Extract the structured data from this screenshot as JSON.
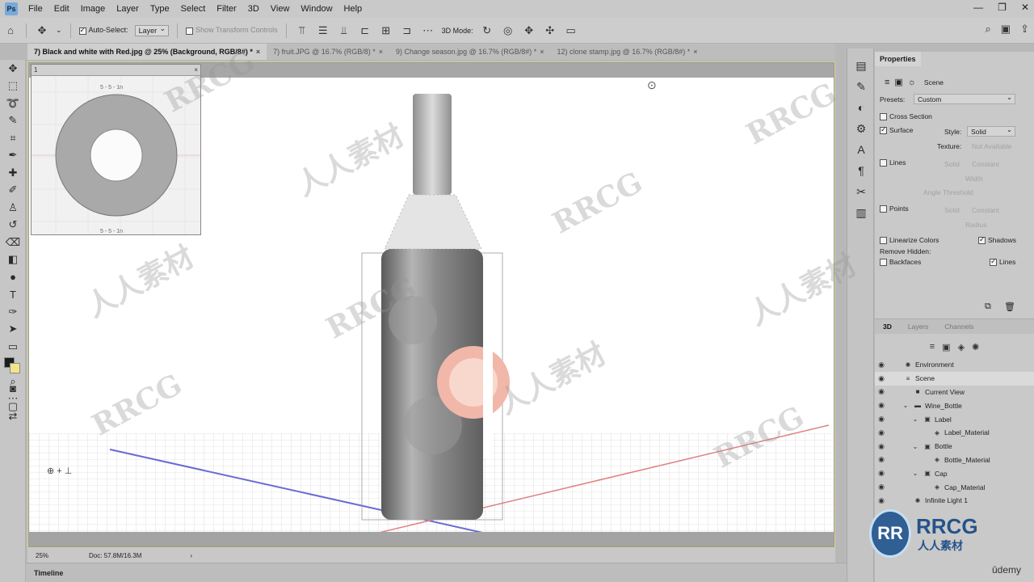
{
  "app": {
    "logo": "Ps"
  },
  "menu": [
    "File",
    "Edit",
    "Image",
    "Layer",
    "Type",
    "Select",
    "Filter",
    "3D",
    "View",
    "Window",
    "Help"
  ],
  "options": {
    "auto_select_label": "Auto-Select:",
    "auto_select_checked": true,
    "auto_select_value": "Layer",
    "transform_controls": "Show Transform Controls",
    "mode_label": "3D Mode:"
  },
  "tabs": [
    {
      "label": "7) Black and white with Red.jpg @ 25% (Background, RGB/8#) *",
      "active": true
    },
    {
      "label": "7) fruit.JPG @ 16.7% (RGB/8) *",
      "active": false
    },
    {
      "label": "9) Change season.jpg @ 16.7% (RGB/8#) *",
      "active": false
    },
    {
      "label": "12) clone stamp.jpg @ 16.7% (RGB/8#) *",
      "active": false
    }
  ],
  "uv_panel": {
    "title": "1",
    "ruler_top": "5 - 5 - 1n",
    "ruler_bottom": "5 - 5 - 1n"
  },
  "status": {
    "zoom": "25%",
    "doc": "Doc: 57.8M/16.3M"
  },
  "timeline": {
    "label": "Timeline"
  },
  "properties": {
    "title": "Properties",
    "mode": "Scene",
    "presets_label": "Presets:",
    "presets_value": "Custom",
    "cross_section": "Cross Section",
    "surface": "Surface",
    "surface_checked": true,
    "style_label": "Style:",
    "style_value": "Solid",
    "texture_label": "Texture:",
    "texture_value": "Not Available",
    "lines": "Lines",
    "lines_style": "Solid",
    "lines_color": "Constant",
    "lines_width": "Width",
    "lines_angle": "Angle Threshold",
    "points": "Points",
    "points_style": "Solid",
    "points_color": "Constant",
    "points_radius": "Radius",
    "linearize": "Linearize Colors",
    "shadows": "Shadows",
    "shadows_checked": true,
    "remove_hidden": "Remove Hidden:",
    "backfaces": "Backfaces",
    "remove_lines": "Lines",
    "remove_lines_checked": true
  },
  "panel3d": {
    "tabs": [
      "3D",
      "Layers",
      "Channels"
    ],
    "tree": [
      {
        "label": "Environment",
        "indent": 0,
        "icon": "environment-icon",
        "glyph": "✺",
        "caret": ""
      },
      {
        "label": "Scene",
        "indent": 0,
        "icon": "scene-icon",
        "glyph": "≡",
        "caret": "",
        "selected": true
      },
      {
        "label": "Current View",
        "indent": 1,
        "icon": "camera-icon",
        "glyph": "■",
        "caret": ""
      },
      {
        "label": "Wine_Bottle",
        "indent": 1,
        "icon": "folder-icon",
        "glyph": "▬",
        "caret": "⌄"
      },
      {
        "label": "Label",
        "indent": 2,
        "icon": "mesh-icon",
        "glyph": "▣",
        "caret": "⌄"
      },
      {
        "label": "Label_Material",
        "indent": 3,
        "icon": "material-icon",
        "glyph": "◈",
        "caret": ""
      },
      {
        "label": "Bottle",
        "indent": 2,
        "icon": "mesh-icon",
        "glyph": "▣",
        "caret": "⌄"
      },
      {
        "label": "Bottle_Material",
        "indent": 3,
        "icon": "material-icon",
        "glyph": "◈",
        "caret": ""
      },
      {
        "label": "Cap",
        "indent": 2,
        "icon": "mesh-icon",
        "glyph": "▣",
        "caret": "⌄"
      },
      {
        "label": "Cap_Material",
        "indent": 3,
        "icon": "material-icon",
        "glyph": "◈",
        "caret": ""
      },
      {
        "label": "Infinite Light 1",
        "indent": 1,
        "icon": "light-icon",
        "glyph": "✺",
        "caret": ""
      }
    ]
  },
  "watermarks": [
    "RRCG",
    "人人素材"
  ],
  "badge": {
    "mark": "RR",
    "name": "RRCG",
    "sub": "人人素材"
  },
  "udemy": "ûdemy",
  "colors": {
    "accent": "#d8d48a",
    "badge": "#2f5f93"
  }
}
